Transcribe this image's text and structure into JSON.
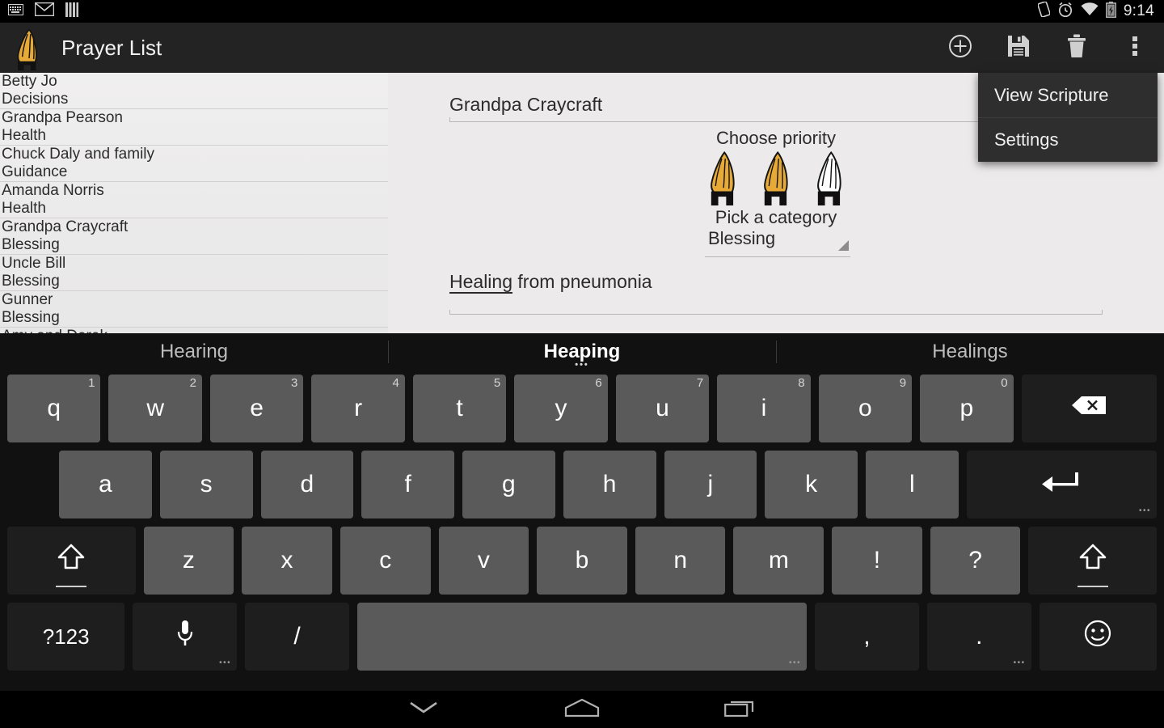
{
  "status_bar": {
    "icons": [
      "keyboard-icon",
      "mail-icon",
      "sim-icon"
    ],
    "right_icons": [
      "vibrate-icon",
      "alarm-icon",
      "wifi-icon",
      "battery-charging-icon"
    ],
    "time": "9:14"
  },
  "action_bar": {
    "app_icon": "praying-hands-icon",
    "title": "Prayer List",
    "actions": [
      {
        "name": "add-button",
        "icon": "plus-circle-icon"
      },
      {
        "name": "save-button",
        "icon": "floppy-disk-icon"
      },
      {
        "name": "delete-button",
        "icon": "trash-icon"
      },
      {
        "name": "overflow-button",
        "icon": "more-vertical-icon"
      }
    ]
  },
  "overflow_menu": {
    "items": [
      {
        "label": "View Scripture"
      },
      {
        "label": "Settings"
      }
    ]
  },
  "prayer_list": {
    "rows": [
      {
        "name": "Betty Jo",
        "category": "Decisions"
      },
      {
        "name": "Grandpa Pearson",
        "category": "Health"
      },
      {
        "name": "Chuck Daly and family",
        "category": "Guidance"
      },
      {
        "name": "Amanda Norris",
        "category": "Health"
      },
      {
        "name": "Grandpa Craycraft",
        "category": "Blessing"
      },
      {
        "name": "Uncle Bill",
        "category": "Blessing"
      },
      {
        "name": "Gunner",
        "category": "Blessing"
      },
      {
        "name": "Amy and Derek",
        "category": ""
      }
    ]
  },
  "detail": {
    "name_value": "Grandpa Craycraft",
    "priority_label": "Choose priority",
    "priority_filled": 2,
    "priority_total": 3,
    "priority_icon": "praying-hands-icon",
    "category_label": "Pick a category",
    "category_value": "Blessing",
    "description_composing": "Healing",
    "description_rest": " from pneumonia"
  },
  "keyboard": {
    "suggestions": [
      {
        "text": "Hearing",
        "active": false
      },
      {
        "text": "Heaping",
        "active": true
      },
      {
        "text": "Healings",
        "active": false
      }
    ],
    "row1": [
      {
        "label": "q",
        "num": "1"
      },
      {
        "label": "w",
        "num": "2"
      },
      {
        "label": "e",
        "num": "3"
      },
      {
        "label": "r",
        "num": "4"
      },
      {
        "label": "t",
        "num": "5"
      },
      {
        "label": "y",
        "num": "6"
      },
      {
        "label": "u",
        "num": "7"
      },
      {
        "label": "i",
        "num": "8"
      },
      {
        "label": "o",
        "num": "9"
      },
      {
        "label": "p",
        "num": "0"
      }
    ],
    "backspace_icon": "backspace-icon",
    "row2": [
      "a",
      "s",
      "d",
      "f",
      "g",
      "h",
      "j",
      "k",
      "l"
    ],
    "enter_icon": "enter-icon",
    "row3_left_shift_icon": "shift-icon",
    "row3": [
      "z",
      "x",
      "c",
      "v",
      "b",
      "n",
      "m",
      "!",
      "?"
    ],
    "row3_right_shift_icon": "shift-icon",
    "row4": {
      "symbols_label": "?123",
      "mic_icon": "microphone-icon",
      "slash_label": "/",
      "space_label": "",
      "comma_label": ",",
      "period_label": ".",
      "emoji_icon": "emoji-icon"
    }
  },
  "nav_bar": {
    "buttons": [
      {
        "name": "hide-keyboard-button",
        "icon": "chevron-down-icon"
      },
      {
        "name": "home-button",
        "icon": "home-icon"
      },
      {
        "name": "recents-button",
        "icon": "recents-icon"
      }
    ]
  },
  "colors": {
    "accent_gold": "#e8aa36",
    "action_bar_bg": "#232323",
    "content_bg": "#eceaea",
    "keyboard_bg": "#111111",
    "key_bg": "#5a5a5a",
    "key_dark_bg": "#1e1e1e"
  }
}
